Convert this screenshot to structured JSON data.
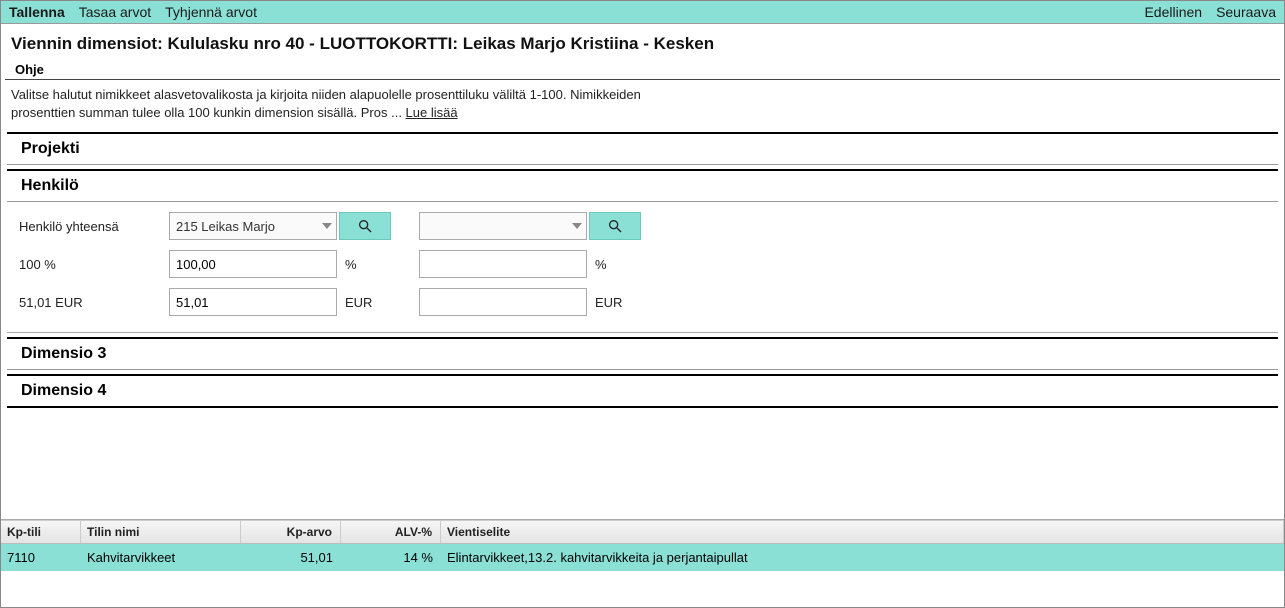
{
  "topbar": {
    "save": "Tallenna",
    "level": "Tasaa arvot",
    "clear": "Tyhjennä arvot",
    "prev": "Edellinen",
    "next": "Seuraava"
  },
  "title": "Viennin dimensiot: Kululasku nro 40 - LUOTTOKORTTI: Leikas Marjo Kristiina - Kesken",
  "ohje": {
    "label": "Ohje",
    "text_line1": "Valitse halutut nimikkeet alasvetovalikosta ja kirjoita niiden alapuolelle prosenttiluku väliltä 1-100. Nimikkeiden",
    "text_line2": "prosenttien summan tulee olla 100 kunkin dimension sisällä. Pros ... ",
    "more": "Lue lisää"
  },
  "sections": {
    "projekti": "Projekti",
    "henkilo": "Henkilö",
    "dim3": "Dimensio 3",
    "dim4": "Dimensio 4"
  },
  "person": {
    "total_label": "Henkilö yhteensä",
    "pct_label": "100 %",
    "eur_label": "51,01 EUR",
    "combo1_value": "215 Leikas Marjo",
    "combo2_value": "",
    "pct1_value": "100,00",
    "pct2_value": "",
    "eur1_value": "51,01",
    "eur2_value": "",
    "pct_unit": "%",
    "eur_unit": "EUR"
  },
  "table": {
    "headers": {
      "acct": "Kp-tili",
      "name": "Tilin nimi",
      "val": "Kp-arvo",
      "vat": "ALV-%",
      "desc": "Vientiselite"
    },
    "row": {
      "acct": "7110",
      "name": "Kahvitarvikkeet",
      "val": "51,01",
      "vat": "14 %",
      "desc": "Elintarvikkeet,13.2. kahvitarvikkeita ja perjantaipullat"
    }
  }
}
